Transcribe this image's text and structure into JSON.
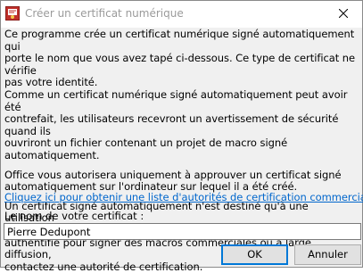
{
  "window": {
    "title": "Créer un certificat numérique",
    "icon": "certificate-icon",
    "close_icon": "close-icon"
  },
  "paragraphs": [
    "Ce programme crée un certificat numérique signé automatiquement qui\nporte le nom que vous avez tapé ci-dessous. Ce type de certificat ne vérifie\npas votre identité.",
    "Comme un certificat numérique signé automatiquement peut avoir été\ncontrefait, les utilisateurs recevront un avertissement de sécurité quand ils\nouvriront un fichier contenant un projet de macro signé automatiquement.",
    "Office vous autorisera uniquement à approuver un certificat signé\nautomatiquement sur l'ordinateur sur lequel il a été créé.",
    "Un certificat signé automatiquement n'est destiné qu'à une utilisation\npersonnelle. Si vous avez besoin d'un certificat de code de signature\nauthentifié pour signer des macros commerciales ou à large diffusion,\ncontactez une autorité de certification."
  ],
  "link_text": "Cliquez ici pour obtenir une liste d'autorités de certification commerciales",
  "name_label": "Le nom de votre certificat :",
  "name_value": "Pierre Dedupont",
  "buttons": {
    "ok": "OK",
    "cancel": "Annuler"
  },
  "colors": {
    "link": "#0066cc",
    "dialog_bg": "#f0f0f0",
    "default_button_border": "#0078d7"
  }
}
